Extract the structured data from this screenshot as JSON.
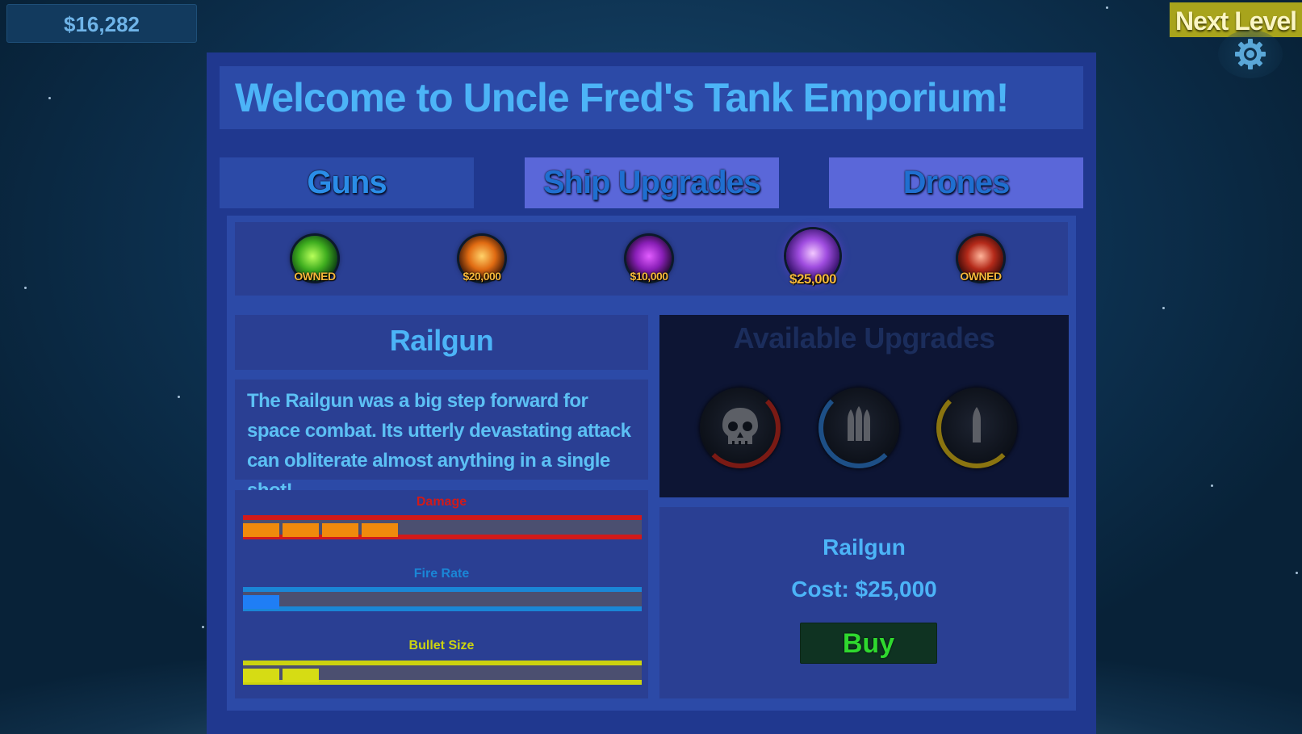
{
  "hud": {
    "money": "$16,282",
    "next_level_label": "Next Level",
    "settings_icon": "gear-icon"
  },
  "shop": {
    "title": "Welcome to Uncle Fred's Tank Emporium!",
    "tabs": [
      {
        "label": "Guns",
        "active": true
      },
      {
        "label": "Ship Upgrades",
        "active": false
      },
      {
        "label": "Drones",
        "active": false
      }
    ],
    "guns": [
      {
        "icon": "green-blaster-icon",
        "label": "OWNED"
      },
      {
        "icon": "flame-cannon-icon",
        "label": "$20,000"
      },
      {
        "icon": "purple-claw-icon",
        "label": "$10,000"
      },
      {
        "icon": "railgun-icon",
        "label": "$25,000",
        "selected": true
      },
      {
        "icon": "rocket-launcher-icon",
        "label": "OWNED"
      }
    ],
    "selected_gun": {
      "name": "Railgun",
      "description": "The Railgun was a big step forward for space combat. Its utterly devastating attack can obliterate almost anything in a single shot!",
      "stats": [
        {
          "label": "Damage",
          "level": 4,
          "color": "#d11a1a",
          "fill_color": "#f08a0c"
        },
        {
          "label": "Fire Rate",
          "level": 1,
          "color": "#1a86d6",
          "fill_color": "#1f7ef5"
        },
        {
          "label": "Bullet Size",
          "level": 2,
          "color": "#cbd30f",
          "fill_color": "#d6dc14"
        }
      ]
    },
    "upgrades": {
      "header": "Available Upgrades",
      "items": [
        {
          "icon": "skull-icon",
          "color": "#8a1a14"
        },
        {
          "icon": "triple-bullet-icon",
          "color": "#1d5a96"
        },
        {
          "icon": "bullet-icon",
          "color": "#8f7a10"
        }
      ]
    },
    "purchase": {
      "name": "Railgun",
      "cost": "Cost: $25,000",
      "buy_label": "Buy"
    }
  }
}
